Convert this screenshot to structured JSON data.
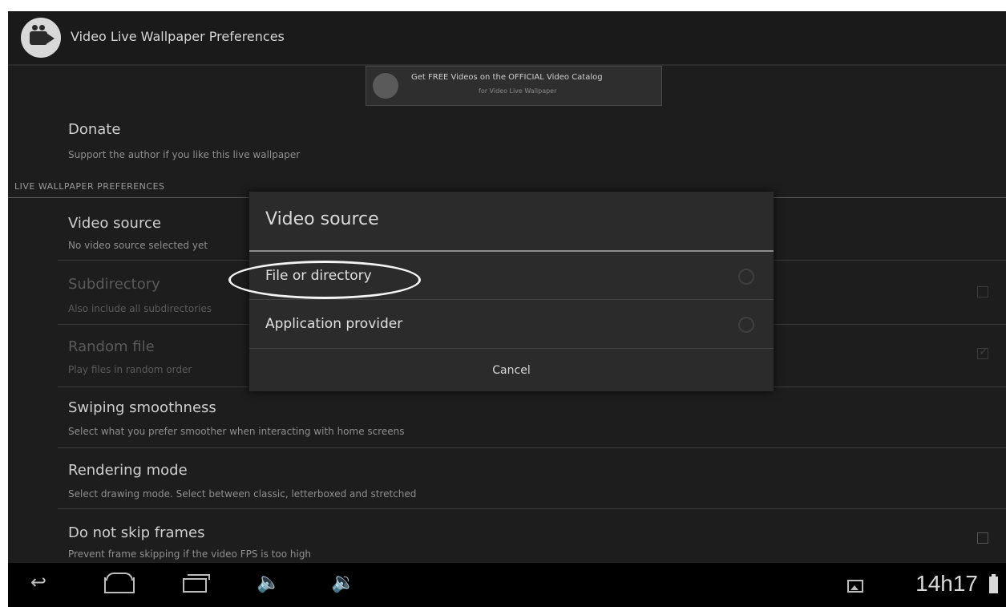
{
  "app": {
    "title": "Video Live Wallpaper Preferences",
    "icon": "video-camera-icon"
  },
  "ad": {
    "line1": "Get FREE Videos on the OFFICIAL Video Catalog",
    "line2": "for Video Live Wallpaper"
  },
  "prefs": {
    "donate": {
      "title": "Donate",
      "summary": "Support the author if you like this live wallpaper"
    },
    "category": "LIVE WALLPAPER PREFERENCES",
    "video_source": {
      "title": "Video source",
      "summary": "No video source selected yet"
    },
    "subdirectory": {
      "title": "Subdirectory",
      "summary": "Also include all subdirectories"
    },
    "shuffle": {
      "title": "Random file",
      "summary": "Play files in random order"
    },
    "swiping": {
      "title": "Swiping smoothness",
      "summary": "Select what you prefer smoother when interacting with home screens"
    },
    "rendering": {
      "title": "Rendering mode",
      "summary": "Select drawing mode. Select between classic, letterboxed and stretched"
    },
    "frames": {
      "title": "Do not skip frames",
      "summary": "Prevent frame skipping if the video FPS is too high"
    }
  },
  "dialog": {
    "title": "Video source",
    "options": [
      "File or directory",
      "Application provider"
    ],
    "cancel": "Cancel"
  },
  "status": {
    "time": "14h17"
  }
}
